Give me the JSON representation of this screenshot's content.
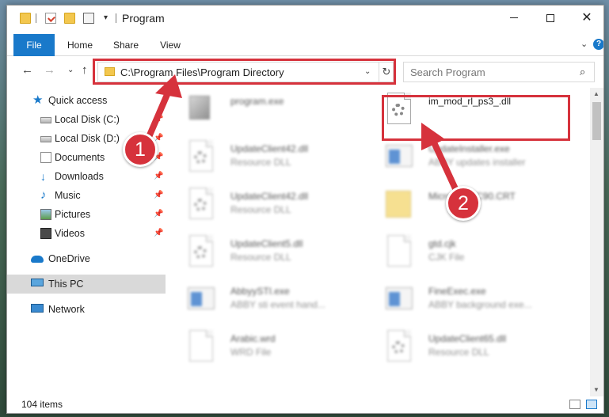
{
  "window": {
    "title": "Program",
    "controls": {
      "minimize": "",
      "maximize": "",
      "close": "✕"
    }
  },
  "ribbon": {
    "tabs": [
      {
        "label": "File",
        "active": true
      },
      {
        "label": "Home"
      },
      {
        "label": "Share"
      },
      {
        "label": "View"
      }
    ],
    "accent_color": "#1979ca"
  },
  "navigation": {
    "back": "←",
    "forward": "→",
    "up": "↑",
    "address": "C:\\Program Files\\Program Directory",
    "search_placeholder": "Search Program"
  },
  "sidebar": {
    "items": [
      {
        "label": "Quick access",
        "icon": "star-icon",
        "pinned": false
      },
      {
        "label": "Local Disk (C:)",
        "icon": "drive-icon",
        "pinned": true
      },
      {
        "label": "Local Disk (D:)",
        "icon": "drive-icon",
        "pinned": true
      },
      {
        "label": "Documents",
        "icon": "documents-icon",
        "pinned": true
      },
      {
        "label": "Downloads",
        "icon": "download-icon",
        "pinned": true
      },
      {
        "label": "Music",
        "icon": "music-icon",
        "pinned": true
      },
      {
        "label": "Pictures",
        "icon": "pictures-icon",
        "pinned": true
      },
      {
        "label": "Videos",
        "icon": "videos-icon",
        "pinned": true
      },
      {
        "label": "OneDrive",
        "icon": "cloud-icon",
        "pinned": false
      },
      {
        "label": "This PC",
        "icon": "computer-icon",
        "pinned": false,
        "selected": true
      },
      {
        "label": "Network",
        "icon": "network-icon",
        "pinned": false
      }
    ]
  },
  "files": [
    {
      "name": "program.exe",
      "type": "",
      "icon": "package-icon"
    },
    {
      "name": "im_mod_rl_ps3_.dll",
      "type": "",
      "icon": "dll-gear-icon",
      "highlighted": true
    },
    {
      "name": "UpdateClient42.dll",
      "type": "Resource DLL",
      "icon": "dll-gear-icon"
    },
    {
      "name": "UpdateInstaller.exe",
      "type": "ABBY updates installer",
      "icon": "exe-icon"
    },
    {
      "name": "UpdateClient42.dll",
      "type": "Resource DLL",
      "icon": "dll-gear-icon"
    },
    {
      "name": "Microsoft.VC90.CRT",
      "type": "",
      "icon": "folder-icon"
    },
    {
      "name": "UpdateClient5.dll",
      "type": "Resource DLL",
      "icon": "dll-gear-icon"
    },
    {
      "name": "gtd.cjk",
      "type": "CJK File",
      "icon": "blank-file-icon"
    },
    {
      "name": "AbbyySTI.exe",
      "type": "ABBY sti event hand...",
      "icon": "exe-icon"
    },
    {
      "name": "FineExec.exe",
      "type": "ABBY background exe...",
      "icon": "exe-icon"
    },
    {
      "name": "Arabic.wrd",
      "type": "WRD File",
      "icon": "blank-file-icon"
    },
    {
      "name": "UpdateClient65.dll",
      "type": "Resource DLL",
      "icon": "dll-gear-icon"
    }
  ],
  "status": {
    "item_count": "104 items"
  },
  "callouts": {
    "step1": "1",
    "step2": "2",
    "color": "#d6323c"
  }
}
